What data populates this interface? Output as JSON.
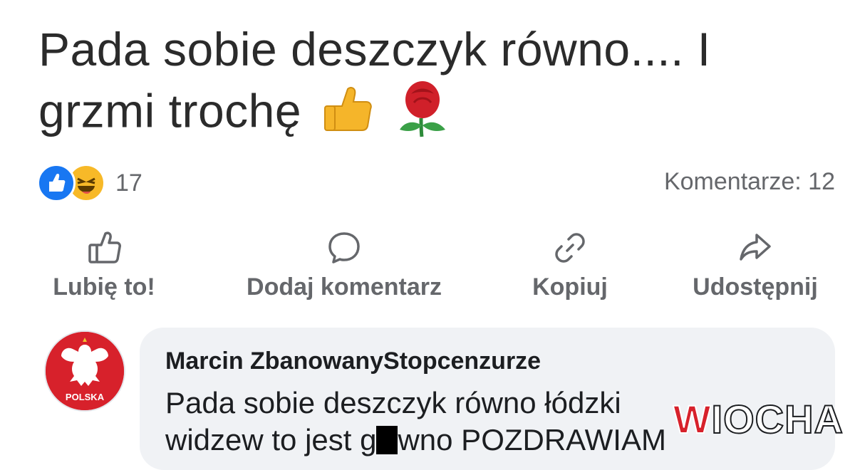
{
  "post": {
    "line1": "Pada sobie deszczyk równo.... I",
    "line2": "grzmi trochę",
    "emojis": [
      "thumbs-up-icon",
      "rose-icon"
    ]
  },
  "reactions": {
    "icons": [
      "like-icon",
      "haha-icon"
    ],
    "count": "17"
  },
  "comments_count": "Komentarze: 12",
  "actions": [
    {
      "label": "Lubię to!",
      "icon": "thumbs-up-outline-icon"
    },
    {
      "label": "Dodaj komentarz",
      "icon": "speech-bubble-icon"
    },
    {
      "label": "Kopiuj",
      "icon": "link-icon"
    },
    {
      "label": "Udostępnij",
      "icon": "share-arrow-icon"
    }
  ],
  "comment": {
    "author": "Marcin ZbanowanyStopcenzurze",
    "text_line1": "Pada sobie deszczyk równo łódzki",
    "text_line2_start": "widzew to jest g",
    "text_line2_end": "wno POZDRAWIAM",
    "avatar_text": "POLSKA"
  },
  "watermark": {
    "w": "W",
    "rest": "IOCHA"
  },
  "colors": {
    "like_blue": "#1877f2",
    "haha_yellow": "#f7b928",
    "muted": "#65676b",
    "bubble": "#f0f2f5",
    "avatar_red": "#d7212b"
  }
}
